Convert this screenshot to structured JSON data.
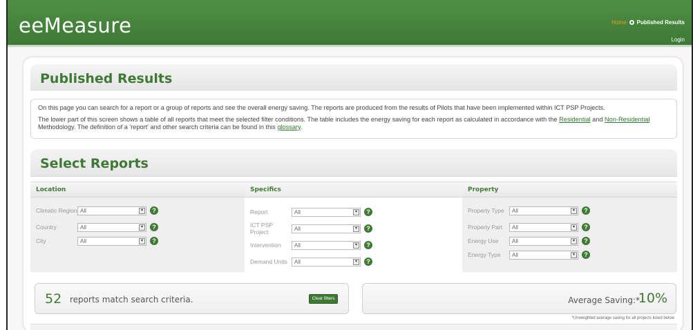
{
  "header": {
    "logo": "eeMeasure",
    "nav_home": "Home",
    "nav_current": "Published Results",
    "login": "Login",
    "brand_color": "#3e7a36",
    "accent_color": "#f39a1e"
  },
  "page": {
    "title": "Published Results",
    "intro_p1": "On this page you can search for a report or a group of reports and see the overall energy saving. The reports are produced from the results of Pilots that have been implemented within ICT PSP Projects.",
    "intro_p2_a": "The lower part of this screen shows a table of all reports that meet the selected filter conditions. The table includes the energy saving for each report as calculated in accordance with the ",
    "link_residential": "Residential",
    "intro_p2_b": " and ",
    "link_nonresidential": "Non-Residential",
    "intro_p2_c": " Methodology. The definition of a 'report' and other search criteria can be found in this ",
    "link_glossary": "glossary",
    "intro_p2_d": "."
  },
  "select": {
    "title": "Select Reports",
    "location": {
      "heading": "Location",
      "filters": [
        {
          "label": "Climatic Region",
          "value": "All"
        },
        {
          "label": "Country",
          "value": "All"
        },
        {
          "label": "City",
          "value": "All"
        }
      ]
    },
    "specifics": {
      "heading": "Specifics",
      "filters": [
        {
          "label": "Report",
          "value": "All"
        },
        {
          "label": "ICT PSP Project",
          "value": "All"
        },
        {
          "label": "Intervention",
          "value": "All"
        },
        {
          "label": "Demand Units",
          "value": "All"
        }
      ]
    },
    "property": {
      "heading": "Property",
      "filters": [
        {
          "label": "Property Type",
          "value": "All"
        },
        {
          "label": "Property Part",
          "value": "All"
        },
        {
          "label": "Energy Use",
          "value": "All"
        },
        {
          "label": "Energy Type",
          "value": "All"
        }
      ]
    }
  },
  "results": {
    "count": "52",
    "count_text": "reports match search criteria.",
    "clear_label": "Clear filters",
    "avg_label": "Average Saving:*",
    "avg_value": "10%",
    "note": "*Unweighted average saving for all projects listed below"
  },
  "icons": {
    "help": "question-icon",
    "dropdown": "dropdown-arrow-icon",
    "nav_sep": "nav-separator-icon"
  }
}
